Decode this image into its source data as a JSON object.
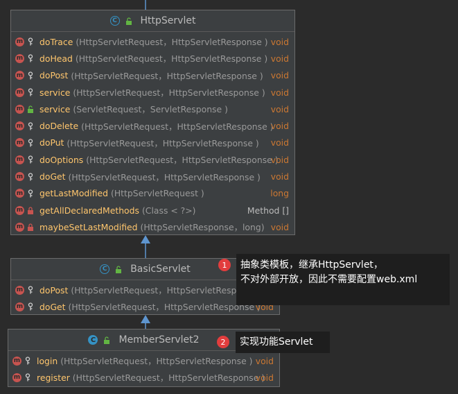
{
  "http_servlet": {
    "title": "HttpServlet",
    "methods": [
      {
        "name": "doTrace",
        "params": "(HttpServletRequest，HttpServletResponse )",
        "ret": "void",
        "vis": "protected"
      },
      {
        "name": "doHead",
        "params": "(HttpServletRequest，HttpServletResponse )",
        "ret": "void",
        "vis": "protected"
      },
      {
        "name": "doPost",
        "params": "(HttpServletRequest，HttpServletResponse )",
        "ret": "void",
        "vis": "protected"
      },
      {
        "name": "service",
        "params": "(HttpServletRequest，HttpServletResponse )",
        "ret": "void",
        "vis": "protected"
      },
      {
        "name": "service",
        "params": "(ServletRequest，ServletResponse )",
        "ret": "void",
        "vis": "public"
      },
      {
        "name": "doDelete",
        "params": "(HttpServletRequest，HttpServletResponse )",
        "ret": "void",
        "vis": "protected"
      },
      {
        "name": "doPut",
        "params": "(HttpServletRequest，HttpServletResponse )",
        "ret": "void",
        "vis": "protected"
      },
      {
        "name": "doOptions",
        "params": "(HttpServletRequest，HttpServletResponse )",
        "ret": "void",
        "vis": "protected"
      },
      {
        "name": "doGet",
        "params": "(HttpServletRequest，HttpServletResponse )",
        "ret": "void",
        "vis": "protected"
      },
      {
        "name": "getLastModified",
        "params": "(HttpServletRequest )",
        "ret": "long",
        "vis": "protected"
      },
      {
        "name": "getAllDeclaredMethods",
        "params": "(Class < ?>)",
        "ret": "Method []",
        "vis": "private"
      },
      {
        "name": "maybeSetLastModified",
        "params": "(HttpServletResponse，long)",
        "ret": "void",
        "vis": "private"
      }
    ]
  },
  "basic_servlet": {
    "title": "BasicServlet",
    "methods": [
      {
        "name": "doPost",
        "params": "(HttpServletRequest，HttpServletResponse )",
        "ret": "void",
        "vis": "protected"
      },
      {
        "name": "doGet",
        "params": "(HttpServletRequest，HttpServletResponse )",
        "ret": "void",
        "vis": "protected"
      }
    ]
  },
  "member_servlet": {
    "title": "MemberServlet2",
    "methods": [
      {
        "name": "login",
        "params": "(HttpServletRequest，HttpServletResponse )",
        "ret": "void",
        "vis": "protected"
      },
      {
        "name": "register",
        "params": "(HttpServletRequest，HttpServletResponse )",
        "ret": "void",
        "vis": "protected"
      }
    ]
  },
  "callouts": [
    {
      "number": "1",
      "line1": "抽象类模板，继承HttpServlet，",
      "line2": "不对外部开放，因此不需要配置web.xml"
    },
    {
      "number": "2",
      "line1": "实现功能Servlet"
    }
  ],
  "colors": {
    "background": "#2b2b2b",
    "box": "#3c3f41",
    "method_name": "#ffc66d",
    "return_type": "#cc7832",
    "method_badge": "#c75450",
    "class_badge": "#3592c4",
    "arrow": "#5e95cf",
    "callout_badge": "#e23d3d"
  },
  "icons": {
    "method": "method-icon",
    "class": "class-icon",
    "abstract_class": "abstract-class-icon",
    "protected": "key-icon",
    "public": "unlock-icon",
    "private": "lock-icon"
  }
}
